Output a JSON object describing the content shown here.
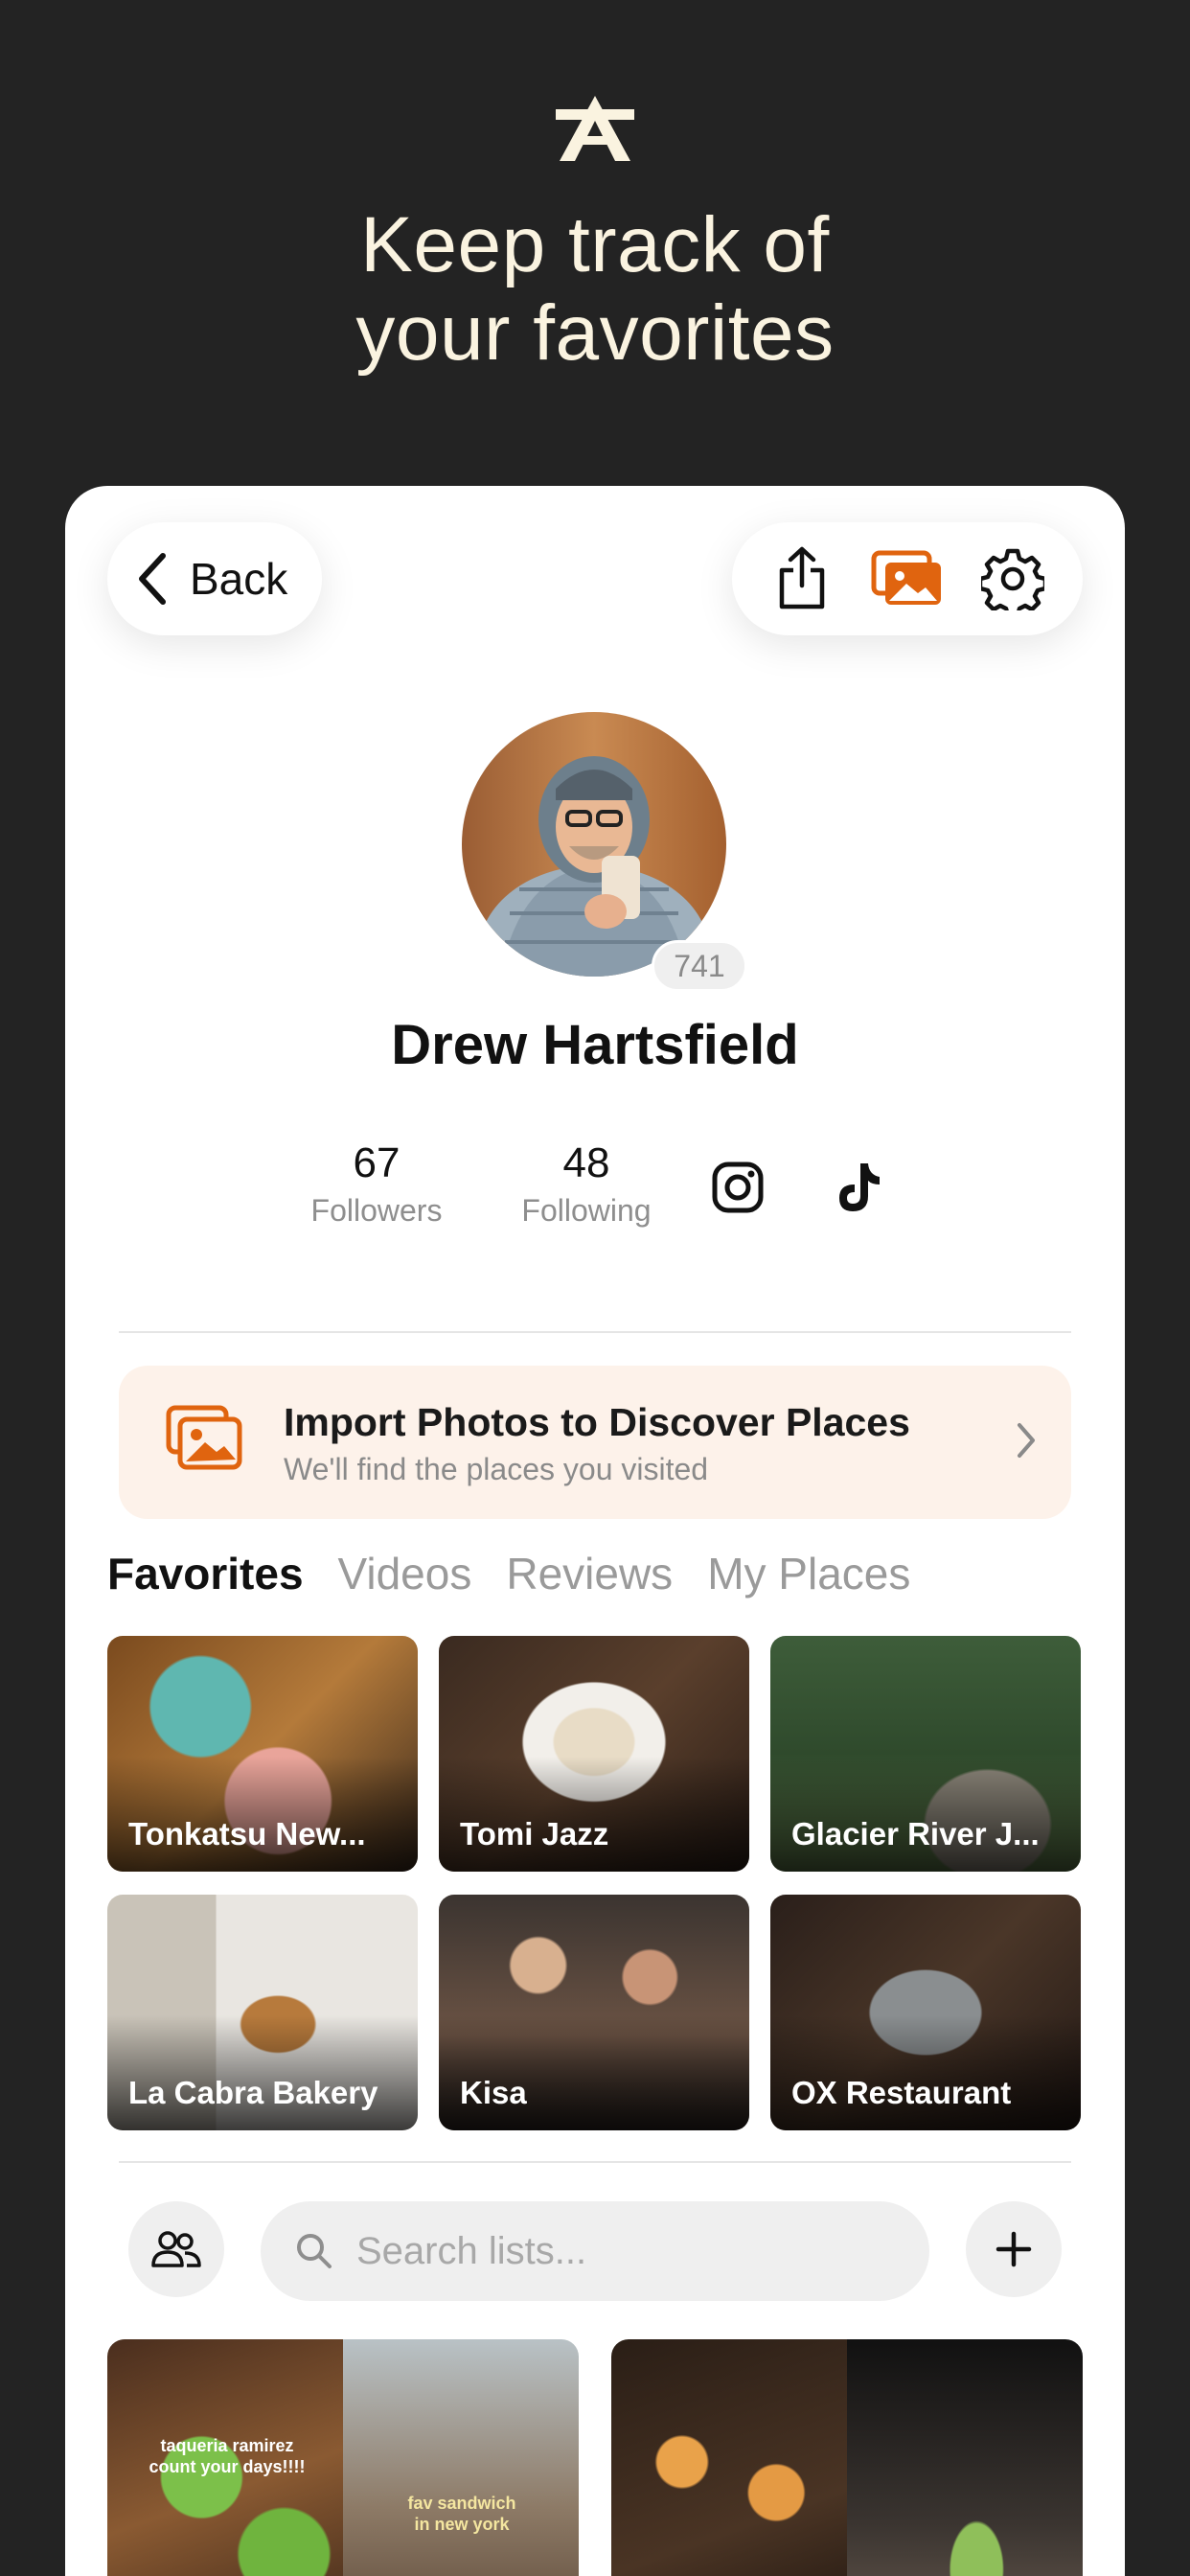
{
  "hero": {
    "headline_line1": "Keep track of",
    "headline_line2": "your favorites",
    "logo_icon": "a-logo-icon"
  },
  "nav": {
    "back_label": "Back",
    "actions": [
      "share-icon",
      "photos-icon",
      "gear-icon"
    ]
  },
  "profile": {
    "name": "Drew Hartsfield",
    "badge": "741",
    "followers_count": "67",
    "followers_label": "Followers",
    "following_count": "48",
    "following_label": "Following",
    "socials": [
      "instagram-icon",
      "tiktok-icon"
    ]
  },
  "import_banner": {
    "title": "Import Photos to Discover Places",
    "subtitle": "We'll find the places you visited"
  },
  "tabs": [
    {
      "label": "Favorites",
      "active": true
    },
    {
      "label": "Videos",
      "active": false
    },
    {
      "label": "Reviews",
      "active": false
    },
    {
      "label": "My Places",
      "active": false
    }
  ],
  "favorites": [
    {
      "label": "Tonkatsu New..."
    },
    {
      "label": "Tomi Jazz"
    },
    {
      "label": "Glacier River J..."
    },
    {
      "label": "La Cabra Bakery"
    },
    {
      "label": "Kisa"
    },
    {
      "label": "OX Restaurant"
    }
  ],
  "lists": {
    "search_placeholder": "Search lists...",
    "cards": [
      {
        "note_left": "taqueria ramirez\ncount your days!!!!",
        "note_right": "fav sandwich\nin new york"
      },
      {
        "note_left": "",
        "note_right": ""
      }
    ]
  },
  "colors": {
    "accent": "#E0640F",
    "background": "#232323",
    "cream": "#FAF3E0",
    "banner": "#FDF2EA"
  }
}
